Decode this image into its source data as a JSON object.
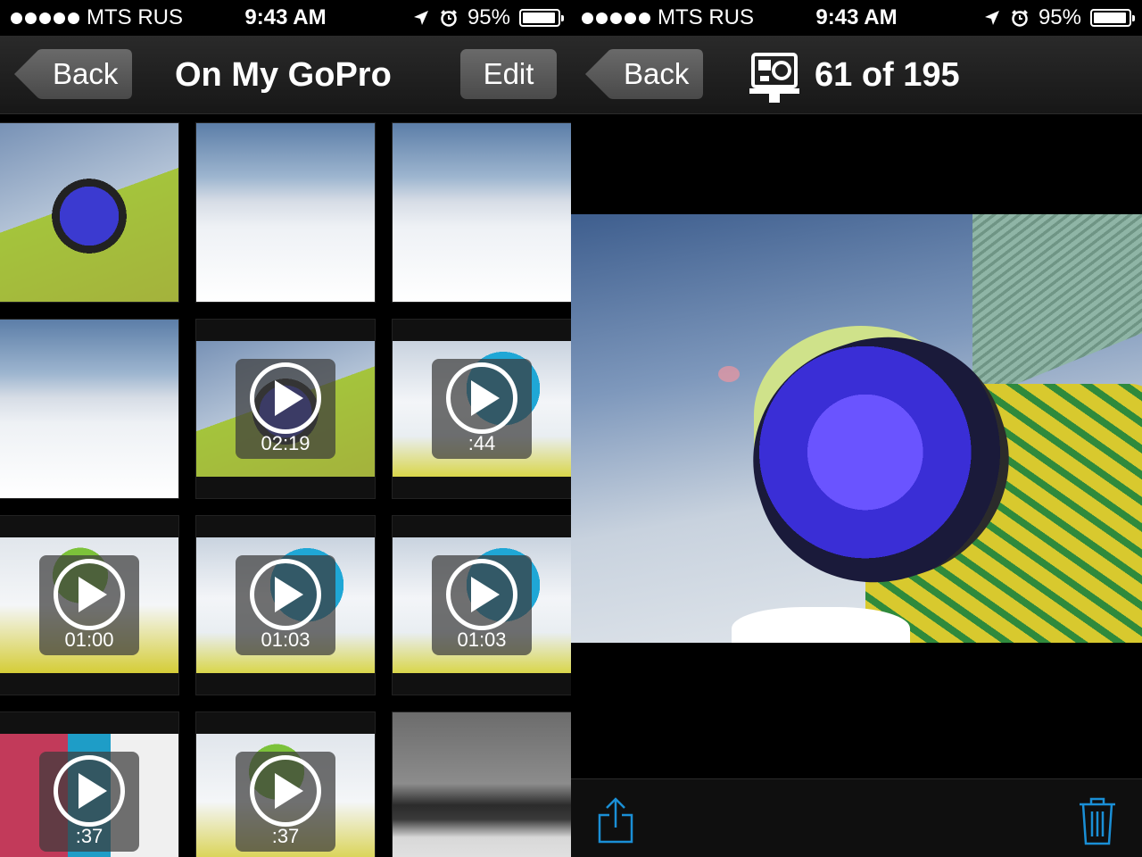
{
  "status": {
    "carrier": "MTS RUS",
    "time": "9:43 AM",
    "battery": "95%"
  },
  "library": {
    "back_label": "Back",
    "title": "On My GoPro",
    "edit_label": "Edit",
    "items": [
      {
        "kind": "photo",
        "duration": ""
      },
      {
        "kind": "photo",
        "duration": ""
      },
      {
        "kind": "photo",
        "duration": ""
      },
      {
        "kind": "photo",
        "duration": ""
      },
      {
        "kind": "video",
        "duration": "02:19"
      },
      {
        "kind": "video",
        "duration": ":44"
      },
      {
        "kind": "video",
        "duration": "01:00"
      },
      {
        "kind": "video",
        "duration": "01:03"
      },
      {
        "kind": "video",
        "duration": "01:03"
      },
      {
        "kind": "video",
        "duration": ":37"
      },
      {
        "kind": "video",
        "duration": ":37"
      },
      {
        "kind": "photo",
        "duration": ""
      }
    ]
  },
  "viewer": {
    "back_label": "Back",
    "counter": "61 of 195",
    "camera_icon": "gopro-camera-icon",
    "toolbar": {
      "share_icon": "share-icon",
      "delete_icon": "trash-icon"
    }
  },
  "colors": {
    "accent": "#1a8fd6",
    "navbar": "#1e1e1e",
    "button": "#5a5a5a"
  }
}
